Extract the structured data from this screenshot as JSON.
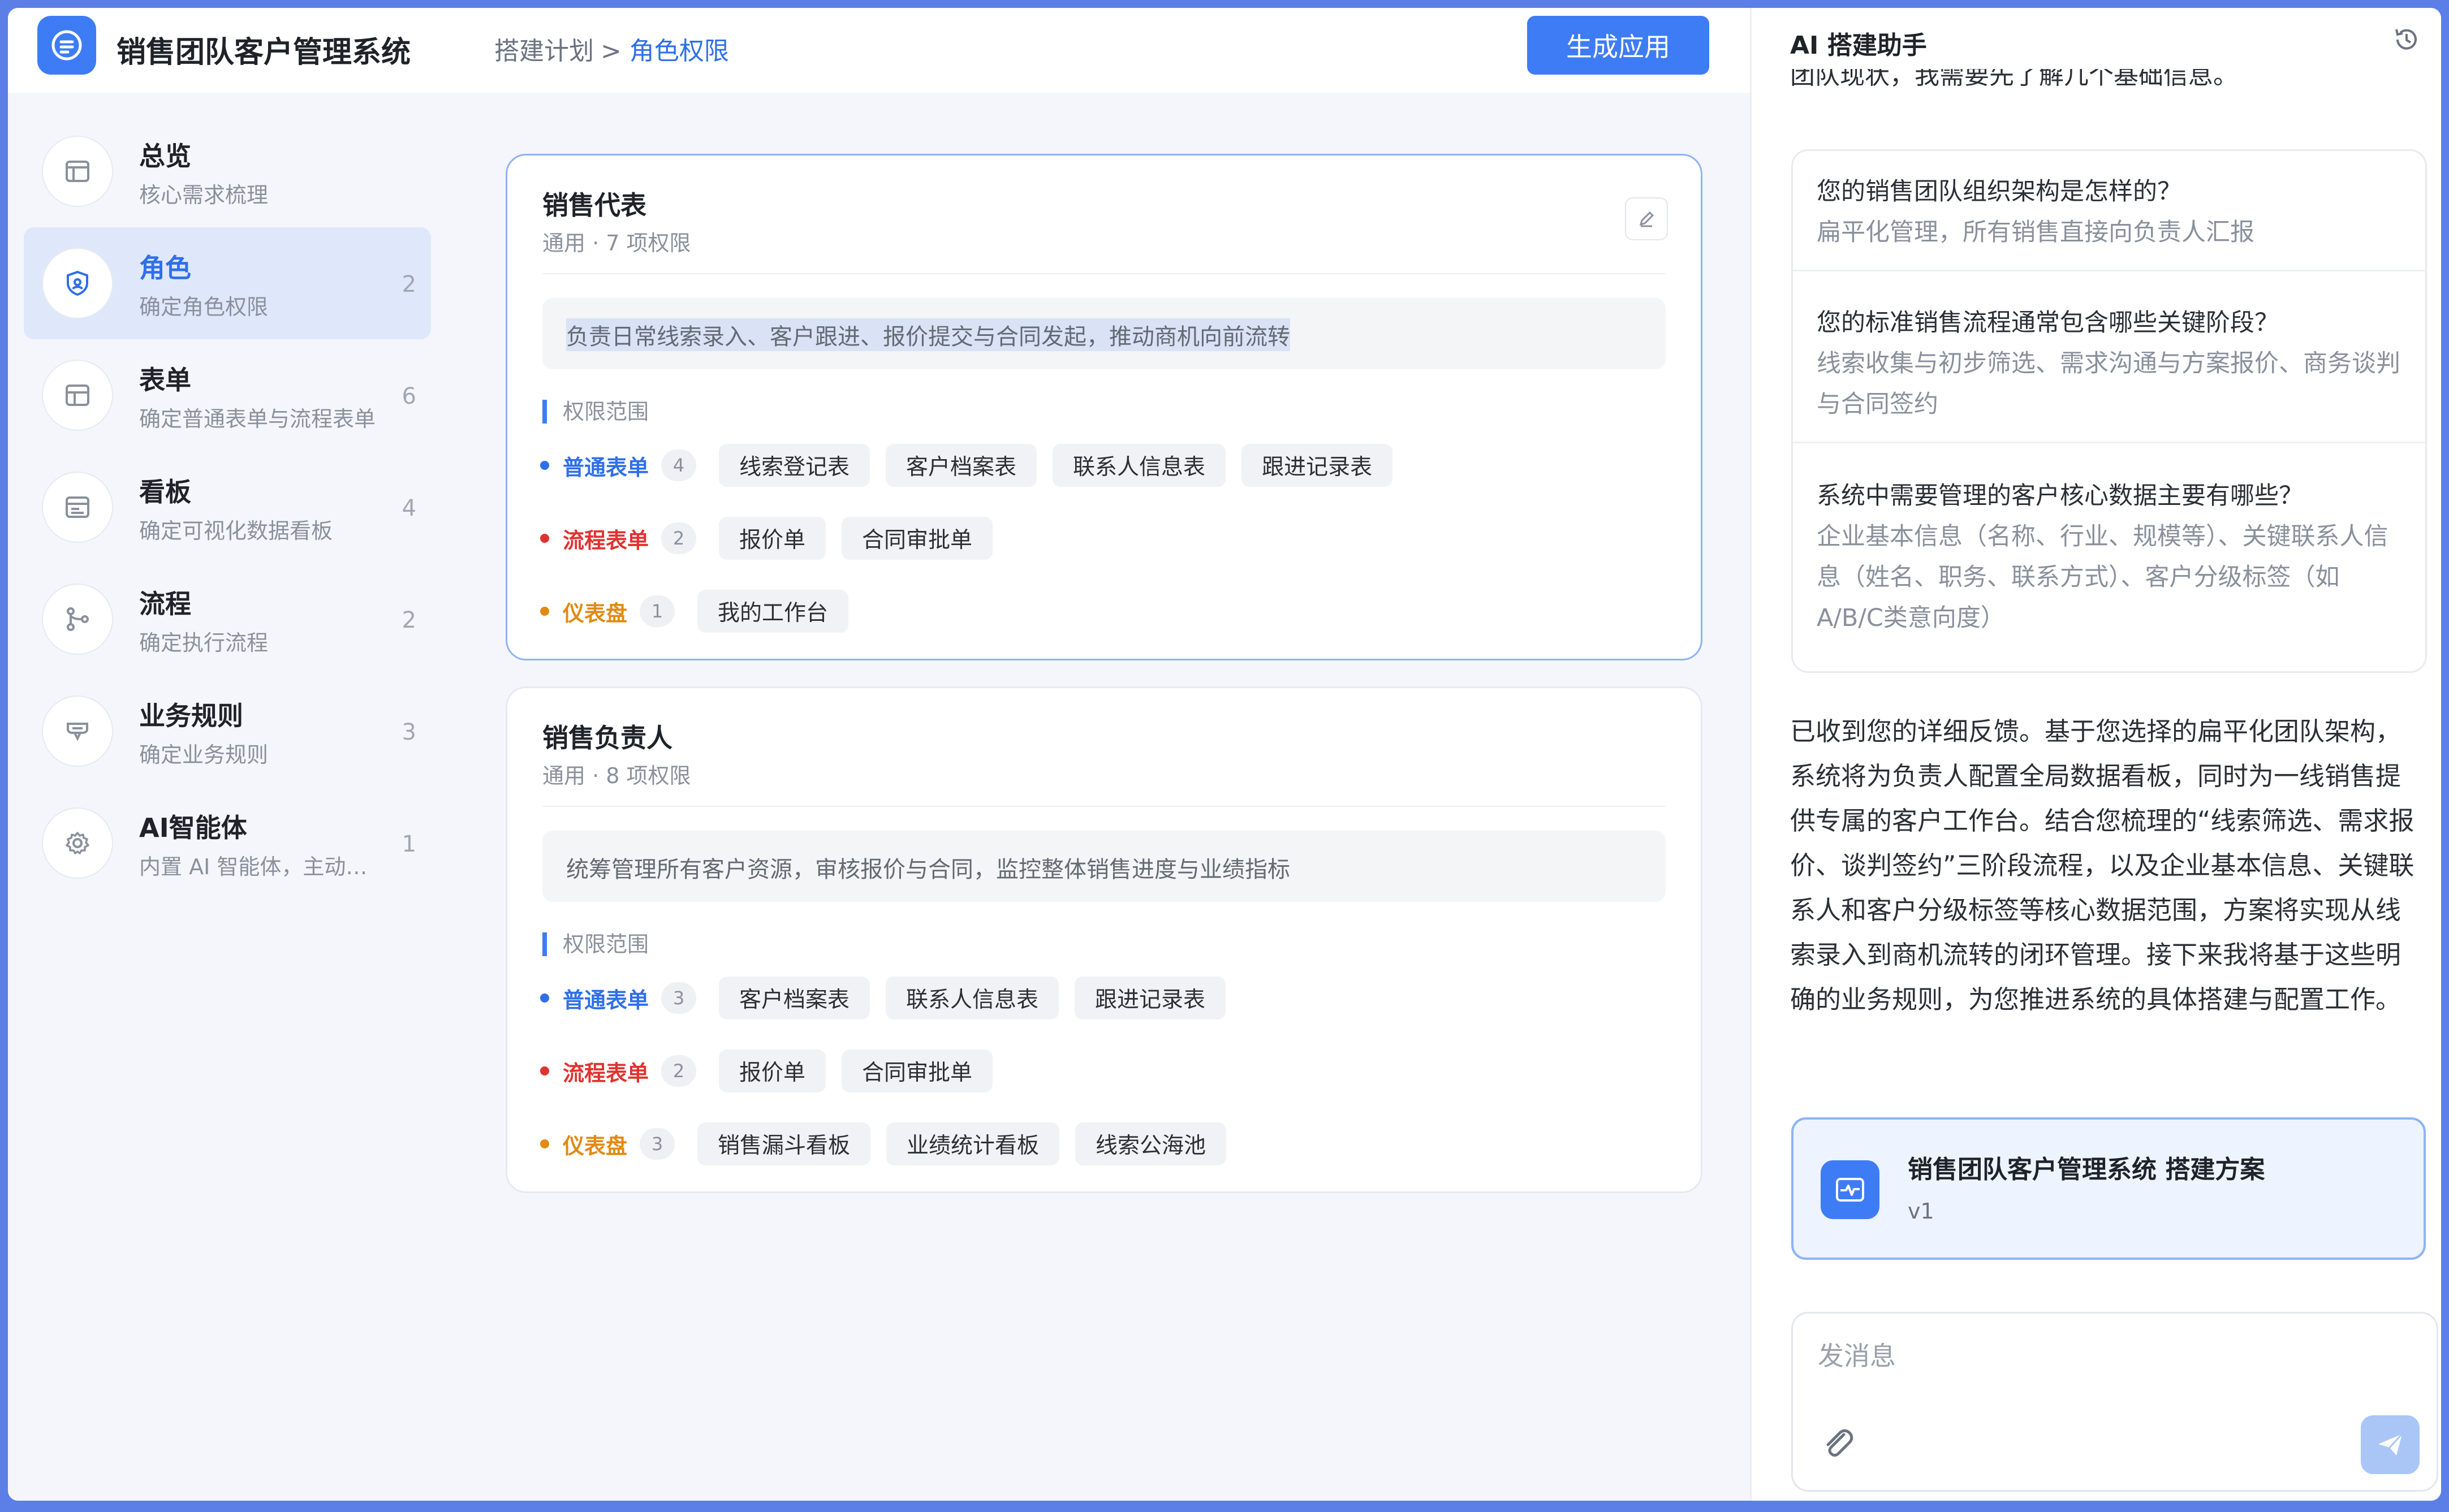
{
  "header": {
    "app_title": "销售团队客户管理系统",
    "breadcrumb_parent": "搭建计划",
    "breadcrumb_sep": ">",
    "breadcrumb_current": "角色权限",
    "generate_label": "生成应用"
  },
  "sidebar": {
    "items": [
      {
        "name": "总览",
        "desc": "核心需求梳理",
        "count": "",
        "icon": "overview-icon"
      },
      {
        "name": "角色",
        "desc": "确定角色权限",
        "count": "2",
        "icon": "role-shield-icon"
      },
      {
        "name": "表单",
        "desc": "确定普通表单与流程表单",
        "count": "6",
        "icon": "form-table-icon"
      },
      {
        "name": "看板",
        "desc": "确定可视化数据看板",
        "count": "4",
        "icon": "dashboard-icon"
      },
      {
        "name": "流程",
        "desc": "确定执行流程",
        "count": "2",
        "icon": "flow-icon"
      },
      {
        "name": "业务规则",
        "desc": "确定业务规则",
        "count": "3",
        "icon": "rule-icon"
      },
      {
        "name": "AI智能体",
        "desc": "内置 AI 智能体，主动执行任务",
        "count": "1",
        "icon": "ai-agent-gear-icon"
      }
    ]
  },
  "roles": [
    {
      "title": "销售代表",
      "meta": "通用 · 7 项权限",
      "desc": "负责日常线索录入、客户跟进、报价提交与合同发起，推动商机向前流转",
      "scope_title": "权限范围",
      "groups": [
        {
          "label": "普通表单",
          "count": "4",
          "color": "#2f6fe8",
          "items": [
            "线索登记表",
            "客户档案表",
            "联系人信息表",
            "跟进记录表"
          ]
        },
        {
          "label": "流程表单",
          "count": "2",
          "color": "#e0322f",
          "items": [
            "报价单",
            "合同审批单"
          ]
        },
        {
          "label": "仪表盘",
          "count": "1",
          "color": "#e08a12",
          "items": [
            "我的工作台"
          ]
        }
      ]
    },
    {
      "title": "销售负责人",
      "meta": "通用 · 8 项权限",
      "desc": "统筹管理所有客户资源，审核报价与合同，监控整体销售进度与业绩指标",
      "scope_title": "权限范围",
      "groups": [
        {
          "label": "普通表单",
          "count": "3",
          "color": "#2f6fe8",
          "items": [
            "客户档案表",
            "联系人信息表",
            "跟进记录表"
          ]
        },
        {
          "label": "流程表单",
          "count": "2",
          "color": "#e0322f",
          "items": [
            "报价单",
            "合同审批单"
          ]
        },
        {
          "label": "仪表盘",
          "count": "3",
          "color": "#e08a12",
          "items": [
            "销售漏斗看板",
            "业绩统计看板",
            "线索公海池"
          ]
        }
      ]
    }
  ],
  "assistant": {
    "title": "AI 搭建助手",
    "cut_text": "团队现状，我需要先了解几个基础信息。",
    "qa": [
      {
        "q": "您的销售团队组织架构是怎样的？",
        "a": "扁平化管理，所有销售直接向负责人汇报"
      },
      {
        "q": "您的标准销售流程通常包含哪些关键阶段？",
        "a": "线索收集与初步筛选、需求沟通与方案报价、商务谈判与合同签约"
      },
      {
        "q": "系统中需要管理的客户核心数据主要有哪些？",
        "a": "企业基本信息（名称、行业、规模等）、关键联系人信息（姓名、职务、联系方式）、客户分级标签（如A/B/C类意向度）"
      }
    ],
    "reply": "已收到您的详细反馈。基于您选择的扁平化团队架构，系统将为负责人配置全局数据看板，同时为一线销售提供专属的客户工作台。结合您梳理的“线索筛选、需求报价、谈判签约”三阶段流程，以及企业基本信息、关键联系人和客户分级标签等核心数据范围，方案将实现从线索录入到商机流转的闭环管理。接下来我将基于这些明确的业务规则，为您推进系统的具体搭建与配置工作。",
    "plan_title": "销售团队客户管理系统  搭建方案",
    "plan_version": "v1",
    "composer_placeholder": "发消息"
  },
  "colors": {
    "accent": "#3d7cf5",
    "frame": "#5b7fe6"
  }
}
